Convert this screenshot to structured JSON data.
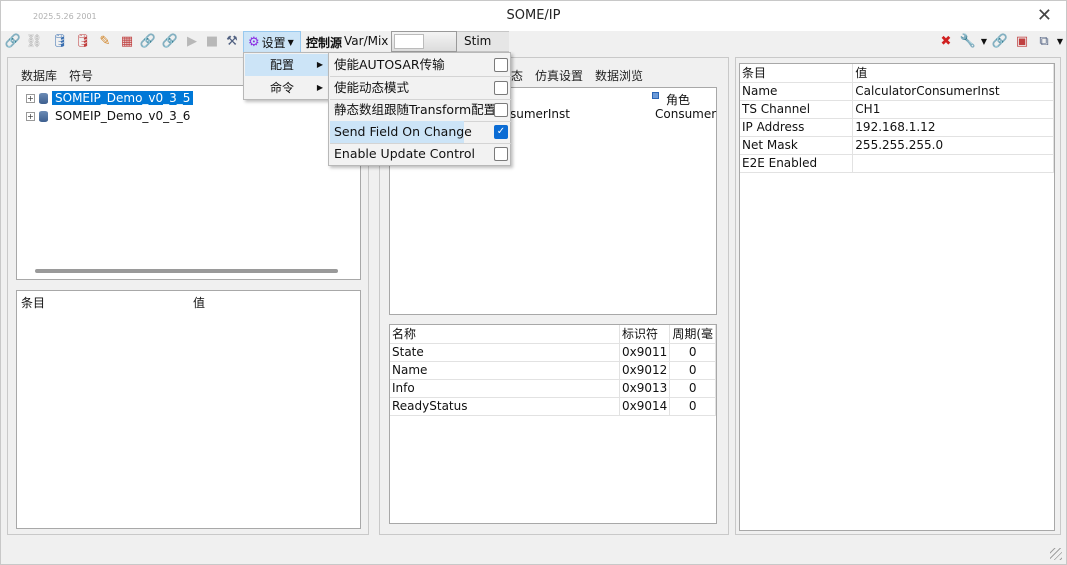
{
  "window": {
    "title": "SOME/IP",
    "date_watermark": "2025.5.26 2001"
  },
  "toolbar": {
    "settings_label": "设置",
    "control_source_label": "控制源",
    "var_mix_label": "Var/Mix",
    "stim_label": "Stim"
  },
  "left": {
    "tabs": [
      "数据库",
      "符号"
    ],
    "tree": [
      "SOMEIP_Demo_v0_3_5",
      "SOMEIP_Demo_v0_3_6"
    ],
    "prop_headers": {
      "item": "条目",
      "value": "值"
    }
  },
  "middle": {
    "tabs_visible": [
      "态",
      "仿真设置",
      "数据浏览"
    ],
    "instance_text": "sumerInst",
    "role_header": "角色",
    "role_value": "Consumer",
    "table_headers": {
      "name": "名称",
      "id": "标识符",
      "period": "周期(毫"
    },
    "rows": [
      {
        "name": "State",
        "id": "0x9011",
        "period": "0"
      },
      {
        "name": "Name",
        "id": "0x9012",
        "period": "0"
      },
      {
        "name": "Info",
        "id": "0x9013",
        "period": "0"
      },
      {
        "name": "ReadyStatus",
        "id": "0x9014",
        "period": "0"
      }
    ]
  },
  "right": {
    "headers": {
      "item": "条目",
      "value": "值"
    },
    "rows": [
      {
        "item": "Name",
        "value": "CalculatorConsumerInst"
      },
      {
        "item": "TS Channel",
        "value": "CH1"
      },
      {
        "item": "IP Address",
        "value": "192.168.1.12"
      },
      {
        "item": "Net Mask",
        "value": "255.255.255.0"
      },
      {
        "item": "E2E Enabled",
        "value": ""
      }
    ]
  },
  "menu": {
    "level1": [
      {
        "label": "配置",
        "highlighted": true
      },
      {
        "label": "命令",
        "highlighted": false
      }
    ],
    "level2": [
      {
        "label": "使能AUTOSAR传输",
        "checked": false
      },
      {
        "label": "使能动态模式",
        "checked": false
      },
      {
        "label": "静态数组跟随Transform配置",
        "checked": false
      },
      {
        "label": "Send Field On Change",
        "checked": true,
        "highlighted": true
      },
      {
        "label": "Enable Update Control",
        "checked": false
      }
    ]
  }
}
